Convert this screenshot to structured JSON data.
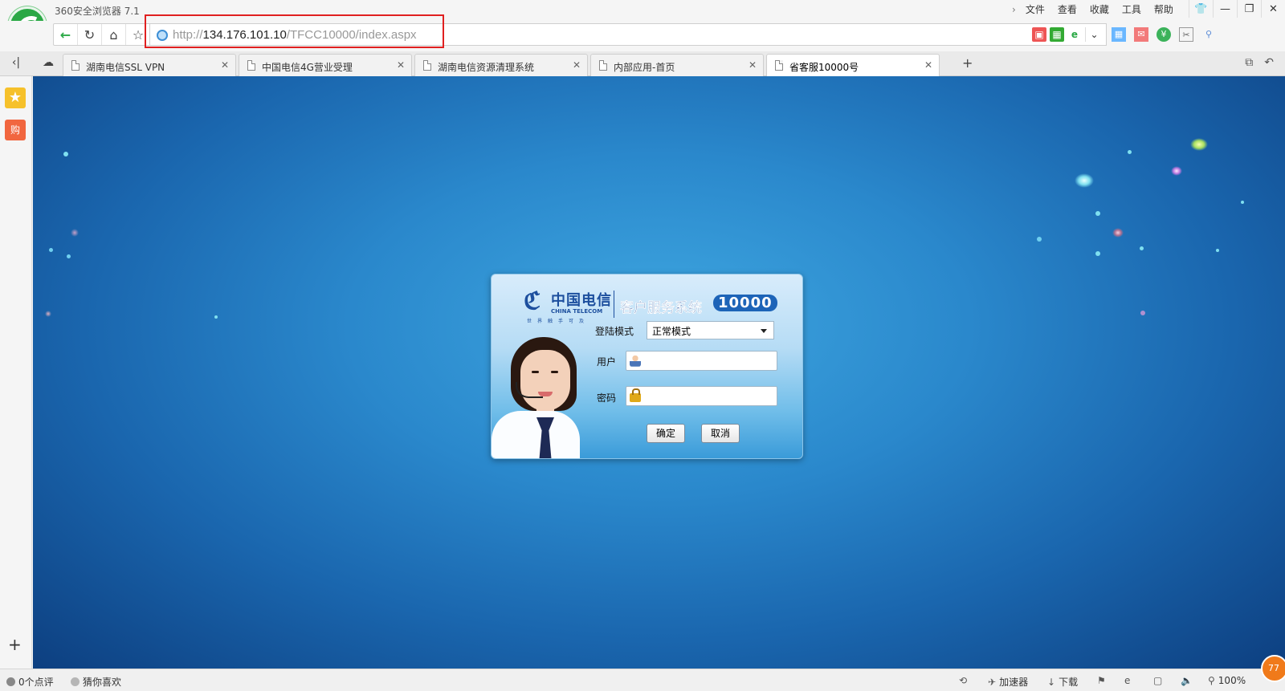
{
  "app": {
    "title": "360安全浏览器 7.1"
  },
  "menu": {
    "items": [
      "文件",
      "查看",
      "收藏",
      "工具",
      "帮助"
    ]
  },
  "address": {
    "scheme": "http://",
    "host": "134.176.101.10",
    "path": "/TFCC10000/index.aspx"
  },
  "tabs": [
    {
      "label": "湖南电信SSL VPN",
      "active": false
    },
    {
      "label": "中国电信4G营业受理",
      "active": false
    },
    {
      "label": "湖南电信资源清理系统",
      "active": false
    },
    {
      "label": "内部应用-首页",
      "active": false
    },
    {
      "label": "省客服10000号",
      "active": true
    }
  ],
  "login": {
    "brand_cn": "中国电信",
    "brand_en": "CHINA TELECOM",
    "slogan": "世界触手可及",
    "system_name": "客户服务系统",
    "system_number": "10000",
    "mode_label": "登陆模式",
    "mode_value": "正常模式",
    "user_label": "用户",
    "password_label": "密码",
    "user_value": "",
    "password_value": "",
    "ok_label": "确定",
    "cancel_label": "取消"
  },
  "statusbar": {
    "reviews": "0个点评",
    "guess": "猜你喜欢",
    "accelerator": "加速器",
    "download": "下载",
    "zoom": "100%"
  },
  "badge": "77",
  "colors": {
    "accent": "#2aa845",
    "highlight": "#e02020",
    "brand_blue": "#1d4f9e"
  }
}
